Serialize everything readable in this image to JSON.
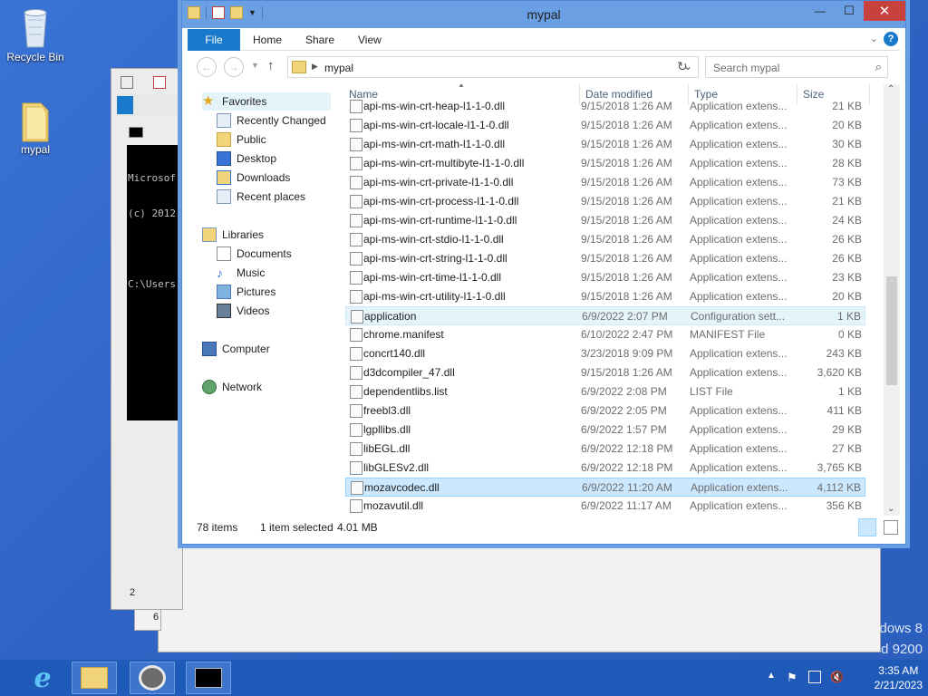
{
  "desktop": {
    "icons": [
      {
        "label": "Recycle Bin"
      },
      {
        "label": "mypal"
      }
    ],
    "watermark": [
      "dows 8",
      "d 9200"
    ]
  },
  "console": {
    "lines": [
      "Microsof",
      "(c) 2012",
      "",
      "C:\\Users"
    ]
  },
  "bg_window": {
    "text_a": "2",
    "text_b": "6"
  },
  "window": {
    "title": "mypal",
    "controls": {
      "minimize": "—",
      "maximize": "☐",
      "close": "✕"
    },
    "ribbon_tabs": [
      "File",
      "Home",
      "Share",
      "View"
    ],
    "address": {
      "path": "mypal"
    },
    "search": {
      "placeholder": "Search mypal"
    },
    "nav": {
      "favorites": "Favorites",
      "favorites_items": [
        "Recently Changed",
        "Public",
        "Desktop",
        "Downloads",
        "Recent places"
      ],
      "libraries": "Libraries",
      "libraries_items": [
        "Documents",
        "Music",
        "Pictures",
        "Videos"
      ],
      "computer": "Computer",
      "network": "Network"
    },
    "columns": [
      "Name",
      "Date modified",
      "Type",
      "Size"
    ],
    "files": [
      {
        "name": "api-ms-win-crt-heap-l1-1-0.dll",
        "date": "9/15/2018 1:26 AM",
        "type": "Application extens...",
        "size": "21 KB"
      },
      {
        "name": "api-ms-win-crt-locale-l1-1-0.dll",
        "date": "9/15/2018 1:26 AM",
        "type": "Application extens...",
        "size": "20 KB"
      },
      {
        "name": "api-ms-win-crt-math-l1-1-0.dll",
        "date": "9/15/2018 1:26 AM",
        "type": "Application extens...",
        "size": "30 KB"
      },
      {
        "name": "api-ms-win-crt-multibyte-l1-1-0.dll",
        "date": "9/15/2018 1:26 AM",
        "type": "Application extens...",
        "size": "28 KB"
      },
      {
        "name": "api-ms-win-crt-private-l1-1-0.dll",
        "date": "9/15/2018 1:26 AM",
        "type": "Application extens...",
        "size": "73 KB"
      },
      {
        "name": "api-ms-win-crt-process-l1-1-0.dll",
        "date": "9/15/2018 1:26 AM",
        "type": "Application extens...",
        "size": "21 KB"
      },
      {
        "name": "api-ms-win-crt-runtime-l1-1-0.dll",
        "date": "9/15/2018 1:26 AM",
        "type": "Application extens...",
        "size": "24 KB"
      },
      {
        "name": "api-ms-win-crt-stdio-l1-1-0.dll",
        "date": "9/15/2018 1:26 AM",
        "type": "Application extens...",
        "size": "26 KB"
      },
      {
        "name": "api-ms-win-crt-string-l1-1-0.dll",
        "date": "9/15/2018 1:26 AM",
        "type": "Application extens...",
        "size": "26 KB"
      },
      {
        "name": "api-ms-win-crt-time-l1-1-0.dll",
        "date": "9/15/2018 1:26 AM",
        "type": "Application extens...",
        "size": "23 KB"
      },
      {
        "name": "api-ms-win-crt-utility-l1-1-0.dll",
        "date": "9/15/2018 1:26 AM",
        "type": "Application extens...",
        "size": "20 KB"
      },
      {
        "name": "application",
        "date": "6/9/2022 2:07 PM",
        "type": "Configuration sett...",
        "size": "1 KB"
      },
      {
        "name": "chrome.manifest",
        "date": "6/10/2022 2:47 PM",
        "type": "MANIFEST File",
        "size": "0 KB"
      },
      {
        "name": "concrt140.dll",
        "date": "3/23/2018 9:09 PM",
        "type": "Application extens...",
        "size": "243 KB"
      },
      {
        "name": "d3dcompiler_47.dll",
        "date": "9/15/2018 1:26 AM",
        "type": "Application extens...",
        "size": "3,620 KB"
      },
      {
        "name": "dependentlibs.list",
        "date": "6/9/2022 2:08 PM",
        "type": "LIST File",
        "size": "1 KB"
      },
      {
        "name": "freebl3.dll",
        "date": "6/9/2022 2:05 PM",
        "type": "Application extens...",
        "size": "411 KB"
      },
      {
        "name": "lgpllibs.dll",
        "date": "6/9/2022 1:57 PM",
        "type": "Application extens...",
        "size": "29 KB"
      },
      {
        "name": "libEGL.dll",
        "date": "6/9/2022 12:18 PM",
        "type": "Application extens...",
        "size": "27 KB"
      },
      {
        "name": "libGLESv2.dll",
        "date": "6/9/2022 12:18 PM",
        "type": "Application extens...",
        "size": "3,765 KB"
      },
      {
        "name": "mozavcodec.dll",
        "date": "6/9/2022 11:20 AM",
        "type": "Application extens...",
        "size": "4,112 KB"
      },
      {
        "name": "mozavutil.dll",
        "date": "6/9/2022 11:17 AM",
        "type": "Application extens...",
        "size": "356 KB"
      }
    ],
    "selected_row": 20,
    "hover_row": 11,
    "status": {
      "items": "78 items",
      "selection": "1 item selected",
      "size": "4.01 MB"
    }
  },
  "taskbar": {
    "clock_time": "3:35 AM",
    "clock_date": "2/21/2023"
  },
  "colors": {
    "accent": "#1979ca",
    "title_bar": "#6a9fe4",
    "close": "#c7423c",
    "taskbar": "#1f5ab8",
    "selection": "#cce8ff"
  }
}
